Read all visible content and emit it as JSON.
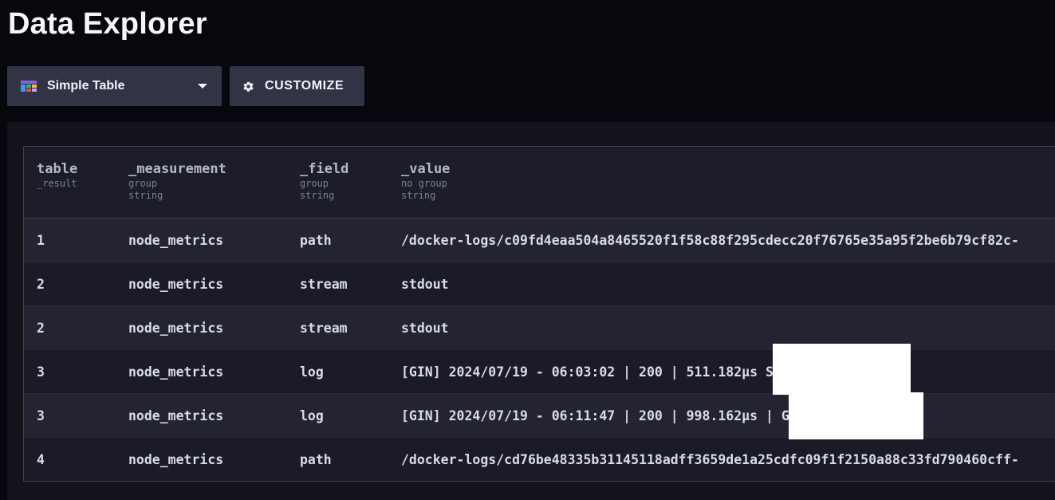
{
  "page": {
    "title": "Data Explorer"
  },
  "toolbar": {
    "visualization_select": {
      "label": "Simple Table",
      "icon": "table-icon"
    },
    "customize_button": {
      "label": "CUSTOMIZE",
      "icon": "gear-icon"
    }
  },
  "table": {
    "columns": [
      {
        "name": "table",
        "sub1": "_result",
        "sub2": ""
      },
      {
        "name": "_measurement",
        "sub1": "group",
        "sub2": "string"
      },
      {
        "name": "_field",
        "sub1": "group",
        "sub2": "string"
      },
      {
        "name": "_value",
        "sub1": "no group",
        "sub2": "string"
      }
    ],
    "rows": [
      {
        "table": "1",
        "measurement": "node_metrics",
        "field": "path",
        "value": "/docker-logs/c09fd4eaa504a8465520f1f58c88f295cdecc20f76765e35a95f2be6b79cf82c-"
      },
      {
        "table": "2",
        "measurement": "node_metrics",
        "field": "stream",
        "value": "stdout"
      },
      {
        "table": "2",
        "measurement": "node_metrics",
        "field": "stream",
        "value": "stdout"
      },
      {
        "table": "3",
        "measurement": "node_metrics",
        "field": "log",
        "value": "[GIN] 2024/07/19 - 06:03:02 | 200 | 511.182µs             S | GET \\\"/service"
      },
      {
        "table": "3",
        "measurement": "node_metrics",
        "field": "log",
        "value": "[GIN] 2024/07/19 - 06:11:47 | 200 | 998.162µs              | GET \\\"/service"
      },
      {
        "table": "4",
        "measurement": "node_metrics",
        "field": "path",
        "value": "/docker-logs/cd76be48335b31145118adff3659de1a25cdfc09f1f2150a88c33fd790460cff-"
      }
    ]
  },
  "colors": {
    "background": "#07070e",
    "panel": "#13131b",
    "button": "#333346",
    "text": "#f4f5fa"
  }
}
